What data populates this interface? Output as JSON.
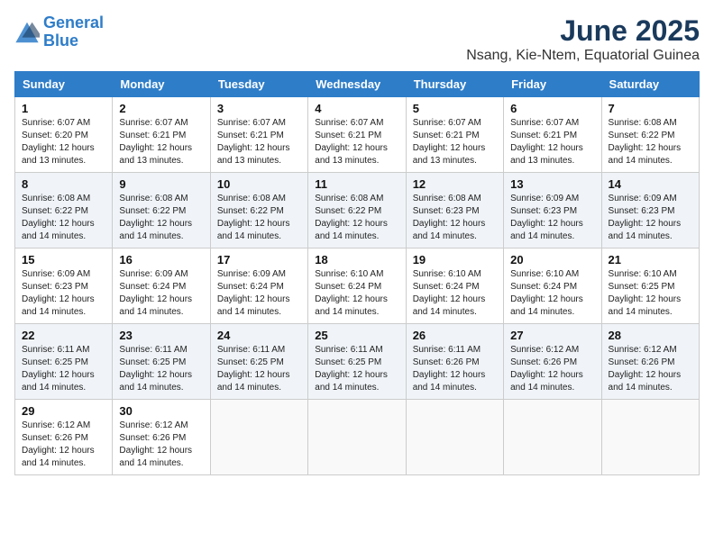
{
  "logo": {
    "line1": "General",
    "line2": "Blue"
  },
  "title": "June 2025",
  "subtitle": "Nsang, Kie-Ntem, Equatorial Guinea",
  "days_of_week": [
    "Sunday",
    "Monday",
    "Tuesday",
    "Wednesday",
    "Thursday",
    "Friday",
    "Saturday"
  ],
  "weeks": [
    [
      {
        "day": 1,
        "sunrise": "6:07 AM",
        "sunset": "6:20 PM",
        "daylight": "12 hours and 13 minutes."
      },
      {
        "day": 2,
        "sunrise": "6:07 AM",
        "sunset": "6:21 PM",
        "daylight": "12 hours and 13 minutes."
      },
      {
        "day": 3,
        "sunrise": "6:07 AM",
        "sunset": "6:21 PM",
        "daylight": "12 hours and 13 minutes."
      },
      {
        "day": 4,
        "sunrise": "6:07 AM",
        "sunset": "6:21 PM",
        "daylight": "12 hours and 13 minutes."
      },
      {
        "day": 5,
        "sunrise": "6:07 AM",
        "sunset": "6:21 PM",
        "daylight": "12 hours and 13 minutes."
      },
      {
        "day": 6,
        "sunrise": "6:07 AM",
        "sunset": "6:21 PM",
        "daylight": "12 hours and 13 minutes."
      },
      {
        "day": 7,
        "sunrise": "6:08 AM",
        "sunset": "6:22 PM",
        "daylight": "12 hours and 14 minutes."
      }
    ],
    [
      {
        "day": 8,
        "sunrise": "6:08 AM",
        "sunset": "6:22 PM",
        "daylight": "12 hours and 14 minutes."
      },
      {
        "day": 9,
        "sunrise": "6:08 AM",
        "sunset": "6:22 PM",
        "daylight": "12 hours and 14 minutes."
      },
      {
        "day": 10,
        "sunrise": "6:08 AM",
        "sunset": "6:22 PM",
        "daylight": "12 hours and 14 minutes."
      },
      {
        "day": 11,
        "sunrise": "6:08 AM",
        "sunset": "6:22 PM",
        "daylight": "12 hours and 14 minutes."
      },
      {
        "day": 12,
        "sunrise": "6:08 AM",
        "sunset": "6:23 PM",
        "daylight": "12 hours and 14 minutes."
      },
      {
        "day": 13,
        "sunrise": "6:09 AM",
        "sunset": "6:23 PM",
        "daylight": "12 hours and 14 minutes."
      },
      {
        "day": 14,
        "sunrise": "6:09 AM",
        "sunset": "6:23 PM",
        "daylight": "12 hours and 14 minutes."
      }
    ],
    [
      {
        "day": 15,
        "sunrise": "6:09 AM",
        "sunset": "6:23 PM",
        "daylight": "12 hours and 14 minutes."
      },
      {
        "day": 16,
        "sunrise": "6:09 AM",
        "sunset": "6:24 PM",
        "daylight": "12 hours and 14 minutes."
      },
      {
        "day": 17,
        "sunrise": "6:09 AM",
        "sunset": "6:24 PM",
        "daylight": "12 hours and 14 minutes."
      },
      {
        "day": 18,
        "sunrise": "6:10 AM",
        "sunset": "6:24 PM",
        "daylight": "12 hours and 14 minutes."
      },
      {
        "day": 19,
        "sunrise": "6:10 AM",
        "sunset": "6:24 PM",
        "daylight": "12 hours and 14 minutes."
      },
      {
        "day": 20,
        "sunrise": "6:10 AM",
        "sunset": "6:24 PM",
        "daylight": "12 hours and 14 minutes."
      },
      {
        "day": 21,
        "sunrise": "6:10 AM",
        "sunset": "6:25 PM",
        "daylight": "12 hours and 14 minutes."
      }
    ],
    [
      {
        "day": 22,
        "sunrise": "6:11 AM",
        "sunset": "6:25 PM",
        "daylight": "12 hours and 14 minutes."
      },
      {
        "day": 23,
        "sunrise": "6:11 AM",
        "sunset": "6:25 PM",
        "daylight": "12 hours and 14 minutes."
      },
      {
        "day": 24,
        "sunrise": "6:11 AM",
        "sunset": "6:25 PM",
        "daylight": "12 hours and 14 minutes."
      },
      {
        "day": 25,
        "sunrise": "6:11 AM",
        "sunset": "6:25 PM",
        "daylight": "12 hours and 14 minutes."
      },
      {
        "day": 26,
        "sunrise": "6:11 AM",
        "sunset": "6:26 PM",
        "daylight": "12 hours and 14 minutes."
      },
      {
        "day": 27,
        "sunrise": "6:12 AM",
        "sunset": "6:26 PM",
        "daylight": "12 hours and 14 minutes."
      },
      {
        "day": 28,
        "sunrise": "6:12 AM",
        "sunset": "6:26 PM",
        "daylight": "12 hours and 14 minutes."
      }
    ],
    [
      {
        "day": 29,
        "sunrise": "6:12 AM",
        "sunset": "6:26 PM",
        "daylight": "12 hours and 14 minutes."
      },
      {
        "day": 30,
        "sunrise": "6:12 AM",
        "sunset": "6:26 PM",
        "daylight": "12 hours and 14 minutes."
      },
      null,
      null,
      null,
      null,
      null
    ]
  ]
}
